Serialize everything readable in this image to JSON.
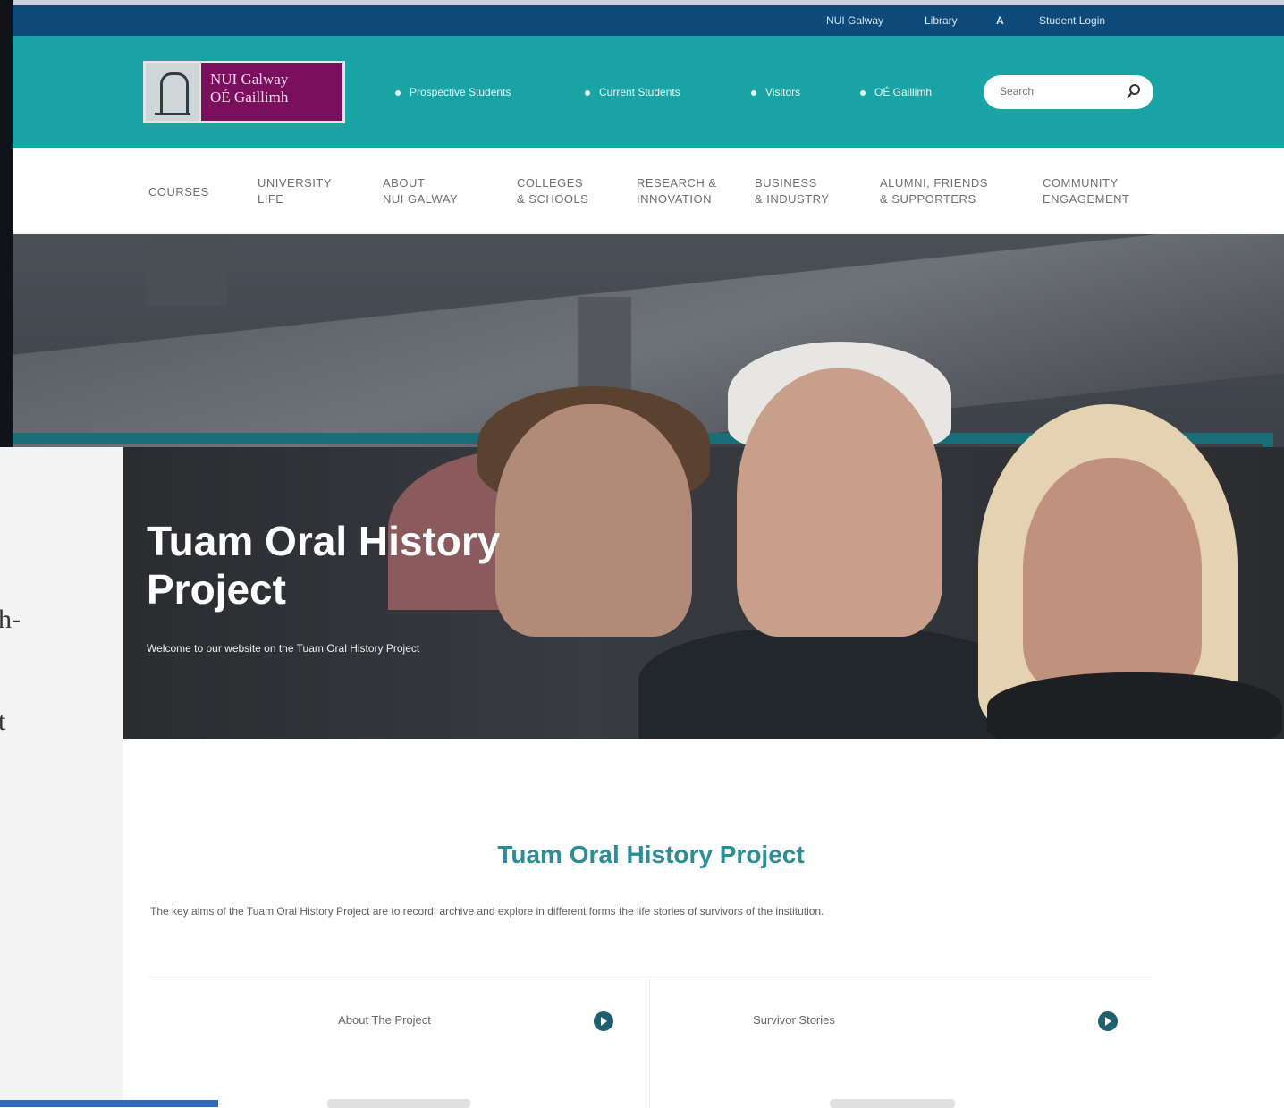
{
  "utility": {
    "links": [
      "NUI Galway",
      "Library",
      "A",
      "Student Login"
    ]
  },
  "logo": {
    "line1": "NUI Galway",
    "line2": "OÉ Gaillimh"
  },
  "header_links": [
    "Prospective Students",
    "Current Students",
    "Visitors",
    "OÉ Gaillimh"
  ],
  "search": {
    "placeholder": "Search"
  },
  "nav": [
    {
      "line1": "COURSES",
      "line2": ""
    },
    {
      "line1": "UNIVERSITY",
      "line2": "LIFE"
    },
    {
      "line1": "ABOUT",
      "line2": "NUI GALWAY"
    },
    {
      "line1": "COLLEGES",
      "line2": "& SCHOOLS"
    },
    {
      "line1": "RESEARCH &",
      "line2": "INNOVATION"
    },
    {
      "line1": "BUSINESS",
      "line2": "& INDUSTRY"
    },
    {
      "line1": "ALUMNI, FRIENDS",
      "line2": "& SUPPORTERS"
    },
    {
      "line1": "COMMUNITY",
      "line2": "ENGAGEMENT"
    }
  ],
  "hero": {
    "title_line1": "Tuam Oral History",
    "title_line2": "Project",
    "subtitle": "Welcome to our website on the Tuam Oral History Project"
  },
  "content": {
    "title": "Tuam Oral History Project",
    "description": "The key aims of the Tuam Oral History Project are to record, archive and explore in different forms the life stories of survivors of the institution."
  },
  "cards": [
    {
      "label": "About The Project"
    },
    {
      "label": "Survivor Stories"
    }
  ],
  "left_panel": {
    "fragments": [
      "h-",
      "t"
    ]
  },
  "colors": {
    "utility_bar": "#0d4a7a",
    "header_teal": "#1aa3a5",
    "logo_purple": "#7a0f5d",
    "hero_frame": "#1a6e78",
    "content_title": "#2b8e96",
    "card_arrow": "#1f5e6e"
  },
  "icons": {
    "search": "search-icon",
    "card_arrow": "arrow-right-circle-icon",
    "logo_emblem": "university-emblem-icon"
  }
}
